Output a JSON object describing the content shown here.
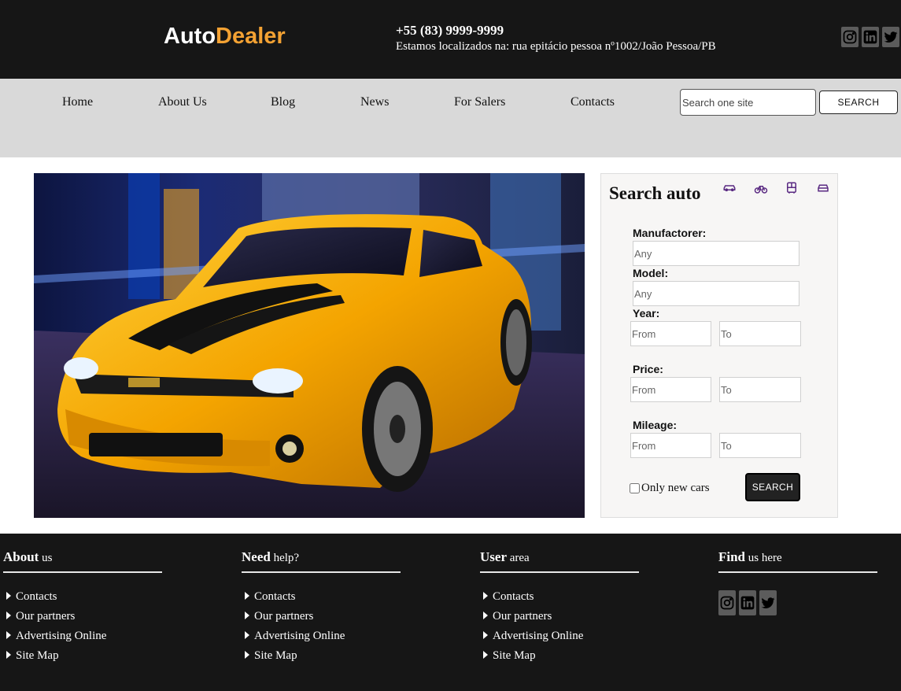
{
  "header": {
    "logo_part1": "Auto",
    "logo_part2": "Dealer",
    "phone": "+55 (83) 9999-9999",
    "address": "Estamos localizados na: rua epitácio pessoa nº1002/João Pessoa/PB",
    "social": [
      "instagram-icon",
      "linkedin-icon",
      "twitter-icon"
    ]
  },
  "nav": {
    "items": [
      "Home",
      "About Us",
      "Blog",
      "News",
      "For Salers",
      "Contacts"
    ],
    "search_placeholder": "Search one site",
    "search_label": "SEARCH"
  },
  "search_panel": {
    "title": "Search auto",
    "vehicle_icons": [
      "car-icon",
      "bicycle-icon",
      "bus-icon",
      "car-front-icon"
    ],
    "manufacturer_label": "Manufactorer:",
    "manufacturer_placeholder": "Any",
    "model_label": "Model:",
    "model_placeholder": "Any",
    "year_label": "Year:",
    "price_label": "Price:",
    "mileage_label": "Mileage:",
    "from_placeholder": "From",
    "to_placeholder": "To",
    "only_new_label": "Only new cars",
    "search_label": "SEARCH"
  },
  "footer": {
    "columns": [
      {
        "head_bold": "About",
        "head_rest": " us",
        "links": [
          "Contacts",
          "Our partners",
          "Advertising Online",
          "Site Map"
        ]
      },
      {
        "head_bold": "Need",
        "head_rest": " help?",
        "links": [
          "Contacts",
          "Our partners",
          "Advertising Online",
          "Site Map"
        ]
      },
      {
        "head_bold": "User",
        "head_rest": " area",
        "links": [
          "Contacts",
          "Our partners",
          "Advertising Online",
          "Site Map"
        ]
      },
      {
        "head_bold": "Find",
        "head_rest": " us here"
      }
    ]
  },
  "colors": {
    "dark_bg": "#161616",
    "nav_bg": "#d9d9d9",
    "brand_accent": "#f4a233",
    "vehicle_icon": "#5a2a82"
  }
}
